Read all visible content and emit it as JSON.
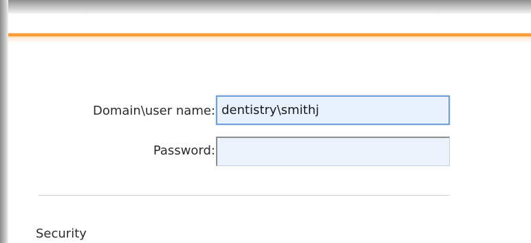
{
  "login": {
    "username_label": "Domain\\user name:",
    "username_value": "dentistry\\smithj",
    "password_label": "Password:",
    "password_value": ""
  },
  "sections": {
    "security_title": "Security"
  },
  "colors": {
    "accent": "#f7931e",
    "input_background": "#e8f1fd",
    "focus_border": "#6f9fd8"
  }
}
